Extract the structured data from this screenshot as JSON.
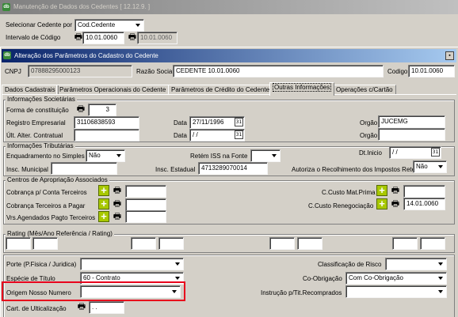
{
  "outer_window": {
    "title": "Manutenção de Dados dos Cedentes [ 12.12.9. ]",
    "select_label": "Selecionar Cedente por",
    "select_value": "Cod.Cedente",
    "interval_label": "Intervalo de Código",
    "code_from": "10.01.0060",
    "code_to": "10.01.0060"
  },
  "inner_window": {
    "title": "Alteração dos Parâmetros do Cadastro do Cedente",
    "cnpj_label": "CNPJ",
    "cnpj_value": "07888295000123",
    "razao_label": "Razão Social",
    "razao_value": "CEDENTE 10.01.0060",
    "codigo_label": "Codigo",
    "codigo_value": "10.01.0060"
  },
  "tabs": [
    {
      "label": "Dados Cadastrais"
    },
    {
      "label": "Parâmetros Operacionais do Cedente"
    },
    {
      "label": "Parâmetros de Crédito do Cedente"
    },
    {
      "label": "Outras Informações"
    },
    {
      "label": "Operações c/Cartão"
    }
  ],
  "societarias": {
    "title": "Informações Societárias",
    "forma_label": "Forma de constituição",
    "forma_value": "3",
    "registro_label": "Registro Empresarial",
    "registro_value": "31106838593",
    "data1_label": "Data",
    "data1_value": "27/11/1996",
    "orgao1_label": "Orgão",
    "orgao1_value": "JUCEMG",
    "ult_label": "Últ. Alter. Contratual",
    "ult_value": "",
    "data2_label": "Data",
    "data2_value": " / /",
    "orgao2_label": "Orgão",
    "orgao2_value": ""
  },
  "tributarias": {
    "title": "Informações Tributárias",
    "simples_label": "Enquadramento no Simples",
    "simples_value": "Não",
    "iss_label": "Retém ISS na Fonte",
    "iss_value": "",
    "dtinicio_label": "Dt.Inicio",
    "dtinicio_value": " / /",
    "municipal_label": "Insc. Municipal",
    "municipal_value": "",
    "estadual_label": "Insc. Estadual",
    "estadual_value": "4713289070014",
    "autoriza_label": "Autoriza o Recolhimento  dos Impostos Reté",
    "autoriza_value": "Não"
  },
  "centros": {
    "title": "Centros de Apropriação Associados",
    "cobranca_conta_label": "Cobrança p/ Conta Terceiros",
    "cobranca_pagar_label": "Cobrança Terceiros a Pagar",
    "vrs_label": "Vrs.Agendados Pagto Terceiros",
    "custo_prima_label": "C.Custo Mat.Prima",
    "custo_reneg_label": "C.Custo Renegociação",
    "custo_reneg_value": "14.01.0060"
  },
  "rating": {
    "title": "Rating (Mês/Ano Referência / Rating)"
  },
  "bottom": {
    "porte_label": "Porte (P.Fisica / Juridica)",
    "porte_value": "",
    "especie_label": "Espécie de Título",
    "especie_value": "60 - Contrato",
    "origem_label": "Origem Nosso Numero",
    "origem_value": "",
    "cart_label": "Cart. de Ulticalização",
    "cart_value": ". .",
    "classificacao_label": "Classificação de Risco",
    "classificacao_value": "",
    "coobrigacao_label": "Co-Obrigação",
    "coobrigacao_value": "Com Co-Obrigação",
    "instrucao_label": "Instrução p/Tit.Recomprados",
    "instrucao_value": ""
  },
  "colors": {
    "highlight": "#e8001c",
    "title_active": "#0a246a",
    "title_inactive": "#808080"
  }
}
